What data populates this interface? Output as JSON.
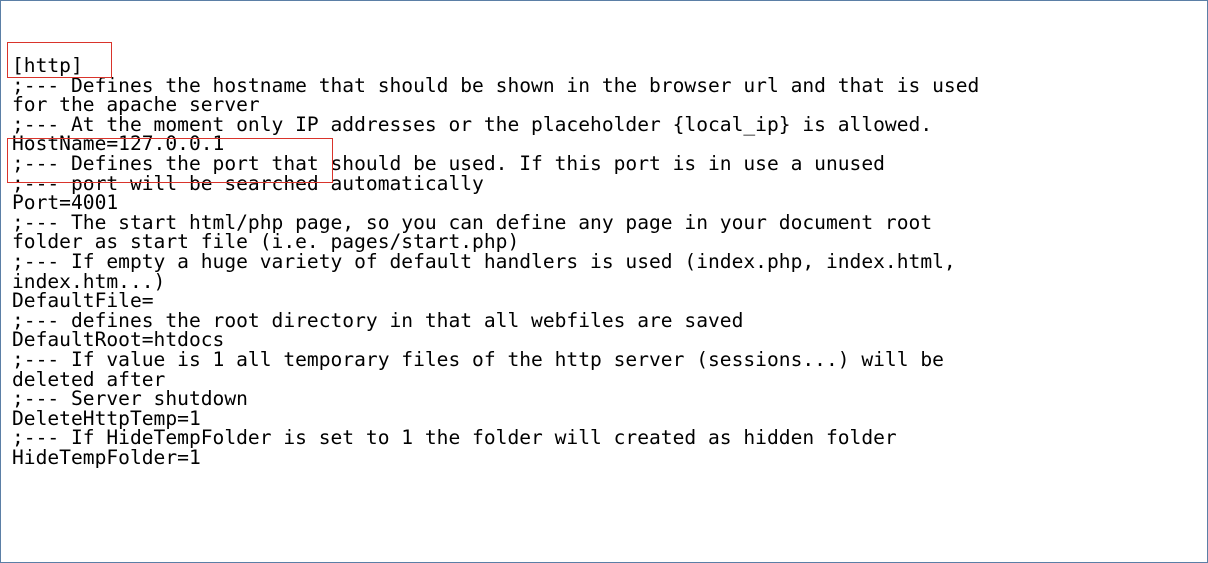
{
  "editor": {
    "lines": [
      "[http]",
      ";--- Defines the hostname that should be shown in the browser url and that is used",
      "for the apache server",
      ";--- At the moment only IP addresses or the placeholder {local_ip} is allowed.",
      "HostName=127.0.0.1",
      ";--- Defines the port that should be used. If this port is in use a unused",
      ";--- port will be searched automatically",
      "Port=4001",
      ";--- The start html/php page, so you can define any page in your document root",
      "folder as start file (i.e. pages/start.php)",
      ";--- If empty a huge variety of default handlers is used (index.php, index.html,",
      "index.htm...)",
      "DefaultFile=",
      ";--- defines the root directory in that all webfiles are saved",
      "DefaultRoot=htdocs",
      ";--- If value is 1 all temporary files of the http server (sessions...) will be",
      "deleted after",
      ";--- Server shutdown",
      "DeleteHttpTemp=1",
      ";--- If HideTempFolder is set to 1 the folder will created as hidden folder",
      "HideTempFolder=1"
    ]
  },
  "colors": {
    "text": "#000000",
    "highlight_border": "#d9342b",
    "frame_border": "#5b7fa6"
  }
}
